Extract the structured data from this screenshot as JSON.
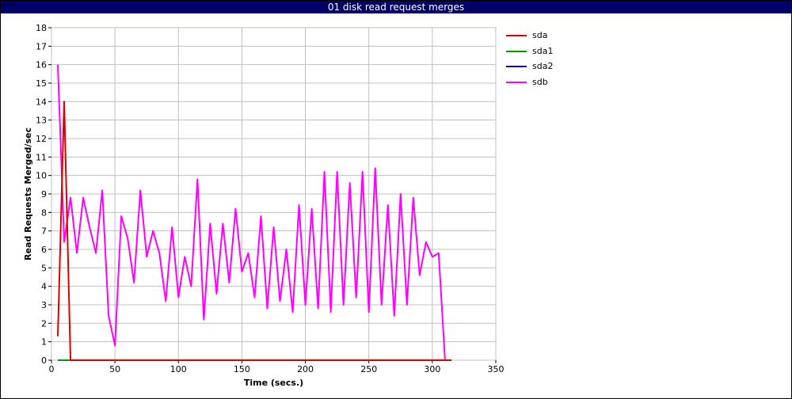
{
  "window": {
    "title": "01 disk read request merges"
  },
  "chart_data": {
    "type": "line",
    "title": "01 disk read request merges",
    "xlabel": "Time (secs.)",
    "ylabel": "Read Requests Merged/sec",
    "xlim": [
      0,
      350
    ],
    "ylim": [
      0,
      18
    ],
    "xticks": [
      0,
      50,
      100,
      150,
      200,
      250,
      300,
      350
    ],
    "yticks": [
      0,
      1,
      2,
      3,
      4,
      5,
      6,
      7,
      8,
      9,
      10,
      11,
      12,
      13,
      14,
      15,
      16,
      17,
      18
    ],
    "grid": true,
    "legend_position": "right",
    "series": [
      {
        "name": "sda",
        "color": "#dd0000",
        "x": [
          5,
          10,
          15,
          315
        ],
        "y": [
          1.3,
          14,
          0,
          0
        ]
      },
      {
        "name": "sda1",
        "color": "#009900",
        "x": [
          5,
          315
        ],
        "y": [
          0,
          0
        ]
      },
      {
        "name": "sda2",
        "color": "#0000cc",
        "x": [
          5,
          315
        ],
        "y": [
          0,
          0
        ]
      },
      {
        "name": "sdb",
        "color": "#ff00ff",
        "x": [
          5,
          10,
          15,
          20,
          25,
          30,
          35,
          40,
          45,
          50,
          55,
          60,
          65,
          70,
          75,
          80,
          85,
          90,
          95,
          100,
          105,
          110,
          115,
          120,
          125,
          130,
          135,
          140,
          145,
          150,
          155,
          160,
          165,
          170,
          175,
          180,
          185,
          190,
          195,
          200,
          205,
          210,
          215,
          220,
          225,
          230,
          235,
          240,
          245,
          250,
          255,
          260,
          265,
          270,
          275,
          280,
          285,
          290,
          295,
          300,
          305,
          310
        ],
        "y": [
          16,
          6.4,
          8.8,
          5.8,
          8.8,
          7.2,
          5.8,
          9.2,
          2.4,
          0.8,
          7.8,
          6.6,
          4.2,
          9.2,
          5.6,
          7.0,
          5.8,
          3.2,
          7.2,
          3.4,
          5.6,
          4.0,
          9.8,
          2.2,
          7.4,
          3.6,
          7.4,
          4.2,
          8.2,
          4.8,
          5.8,
          3.4,
          7.8,
          2.8,
          7.2,
          3.2,
          6.0,
          2.6,
          8.4,
          3.0,
          8.2,
          2.8,
          10.2,
          2.6,
          10.2,
          3.0,
          9.6,
          3.4,
          10.2,
          2.6,
          10.4,
          3.0,
          8.4,
          2.4,
          9.0,
          3.0,
          8.8,
          4.6,
          6.4,
          5.6,
          5.8,
          0
        ]
      }
    ]
  }
}
